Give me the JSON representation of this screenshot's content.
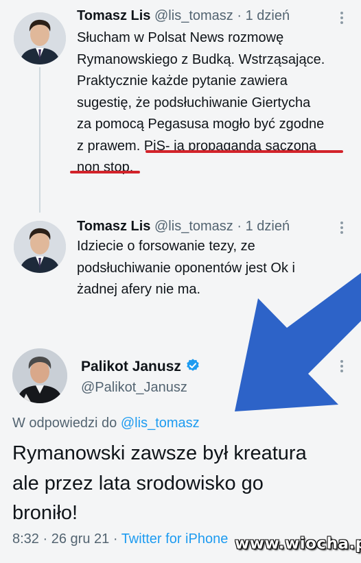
{
  "tweets": [
    {
      "name": "Tomasz Lis",
      "handle": "@lis_tomasz",
      "separator": "·",
      "time": "1 dzień",
      "lines": [
        "Słucham w Polsat News rozmowę",
        "Rymanowskiego z Budką. Wstrząsające.",
        "Praktycznie każde pytanie zawiera",
        "sugestię, że podsłuchiwanie Giertycha",
        "za pomocą Pegasusa mogło być zgodne",
        "z prawem. PiS- ia propaganda sączona",
        "non stop."
      ],
      "avatar_icon": "man-portrait-icon"
    },
    {
      "name": "Tomasz Lis",
      "handle": "@lis_tomasz",
      "separator": "·",
      "time": "1 dzień",
      "lines": [
        "Idziecie o forsowanie tezy, ze",
        "podsłuchiwanie oponentów jest Ok i",
        "żadnej afery nie ma."
      ],
      "avatar_icon": "man-portrait-icon"
    }
  ],
  "main_tweet": {
    "name": "Palikot Janusz",
    "handle": "@Palikot_Janusz",
    "verified_icon": "verified-badge-icon",
    "reply_prefix": "W odpowiedzi do",
    "reply_handle": "@lis_tomasz",
    "lines": [
      "Rymanowski zawsze był kreatura",
      "ale przez lata srodowisko go",
      "broniło!"
    ],
    "time": "8:32",
    "separator": "·",
    "date": "26 gru 21",
    "separator2": "·",
    "source": "Twitter for iPhone"
  },
  "overlay": {
    "watermark": "www.wiocha.pl",
    "arrow_color": "#2d63c8",
    "underline_color": "#d2232a"
  },
  "colors": {
    "link": "#1d9bf0",
    "secondary_text": "#536471",
    "background": "#f4f5f6"
  }
}
